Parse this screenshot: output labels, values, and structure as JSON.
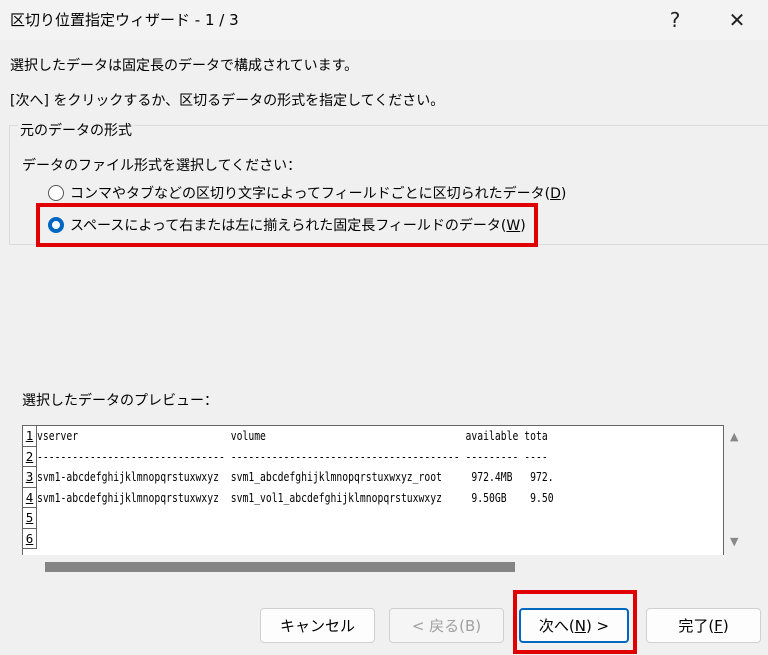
{
  "window": {
    "title": "区切り位置指定ウィザード - 1 / 3",
    "help": "?",
    "close": "✕"
  },
  "intro": {
    "line1": "選択したデータは固定長のデータで構成されています。",
    "line2": "[次へ] をクリックするか、区切るデータの形式を指定してください。"
  },
  "group": {
    "label": "元のデータの形式",
    "prompt": "データのファイル形式を選択してください：",
    "options": [
      {
        "label": "コンマやタブなどの区切り文字によってフィールドごとに区切られたデータ(",
        "key": "D",
        "selected": false
      },
      {
        "label": "スペースによって右または左に揃えられた固定長フィールドのデータ(",
        "key": "W",
        "selected": true
      }
    ]
  },
  "preview": {
    "label": "選択したデータのプレビュー：",
    "rows": [
      {
        "n": "1",
        "text": "vserver                          volume                                  available tota"
      },
      {
        "n": "2",
        "text": "-------------------------------- --------------------------------------- --------- ----"
      },
      {
        "n": "3",
        "text": "svm1-abcdefghijklmnopqrstuxwxyz  svm1_abcdefghijklmnopqrstuxwxyz_root     972.4MB   972."
      },
      {
        "n": "4",
        "text": "svm1-abcdefghijklmnopqrstuxwxyz  svm1_vol1_abcdefghijklmnopqrstuxwxyz     9.50GB    9.50"
      },
      {
        "n": "5",
        "text": ""
      },
      {
        "n": "6",
        "text": ""
      }
    ]
  },
  "buttons": {
    "cancel": "キャンセル",
    "back": "< 戻る(B)",
    "next_pre": "次へ(",
    "next_key": "N",
    "next_post": ") >",
    "finish_pre": "完了(",
    "finish_key": "F",
    "finish_post": ")"
  }
}
